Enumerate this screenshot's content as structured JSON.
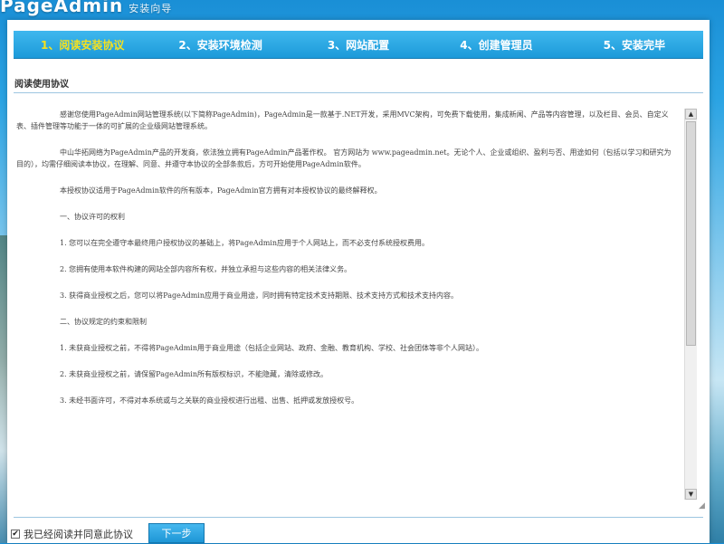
{
  "brand": {
    "logo_text": "PageAdmin",
    "logo_sub": "安装向导"
  },
  "steps": [
    {
      "label": "1、阅读安装协议",
      "active": true
    },
    {
      "label": "2、安装环境检测",
      "active": false
    },
    {
      "label": "3、网站配置",
      "active": false
    },
    {
      "label": "4、创建管理员",
      "active": false
    },
    {
      "label": "5、安装完毕",
      "active": false
    }
  ],
  "section": {
    "title": "阅读使用协议"
  },
  "agreement": {
    "paragraphs": [
      "感谢您使用PageAdmin网站管理系统(以下简称PageAdmin)，PageAdmin是一款基于.NET开发，采用MVC架构，可免费下载使用，集成新闻、产品等内容管理，以及栏目、会员、自定义表、插件管理等功能于一体的可扩展的企业级网站管理系统。",
      "中山华拓网络为PageAdmin产品的开发商，依法独立拥有PageAdmin产品著作权。 官方网站为 www.pageadmin.net。无论个人、企业或组织、盈利与否、用途如何（包括以学习和研究为目的），均需仔细阅读本协议，在理解、同意、并遵守本协议的全部条款后，方可开始使用PageAdmin软件。",
      "本授权协议适用于PageAdmin软件的所有版本，PageAdmin官方拥有对本授权协议的最终解释权。",
      "一、协议许可的权利",
      "1. 您可以在完全遵守本最终用户授权协议的基础上，将PageAdmin应用于个人网站上，而不必支付系统授权费用。",
      "2. 您拥有使用本软件构建的网站全部内容所有权，并独立承担与这些内容的相关法律义务。",
      "3. 获得商业授权之后，您可以将PageAdmin应用于商业用途，同时拥有特定技术支持期限、技术支持方式和技术支持内容。",
      "二、协议规定的约束和限制",
      "1. 未获商业授权之前，不得将PageAdmin用于商业用途（包括企业网站、政府、金融、教育机构、学校、社会团体等非个人网站）。",
      "2. 未获商业授权之前，请保留PageAdmin所有版权标识，不能隐藏，清除或修改。",
      "3. 未经书面许可，不得对本系统或与之关联的商业授权进行出租、出售、抵押或发放授权号。"
    ]
  },
  "footer": {
    "agree_label": "我已经阅读并同意此协议",
    "agree_checked": true,
    "next_label": "下一步"
  },
  "icons": {
    "scroll_up": "triangle-up",
    "scroll_down": "triangle-down",
    "resize_grip": "resize-grip",
    "checkmark": "check"
  },
  "colors": {
    "step_bar": "#1c9ad9",
    "active_step_text": "#f6e11f",
    "next_button": "#1e96d6"
  }
}
